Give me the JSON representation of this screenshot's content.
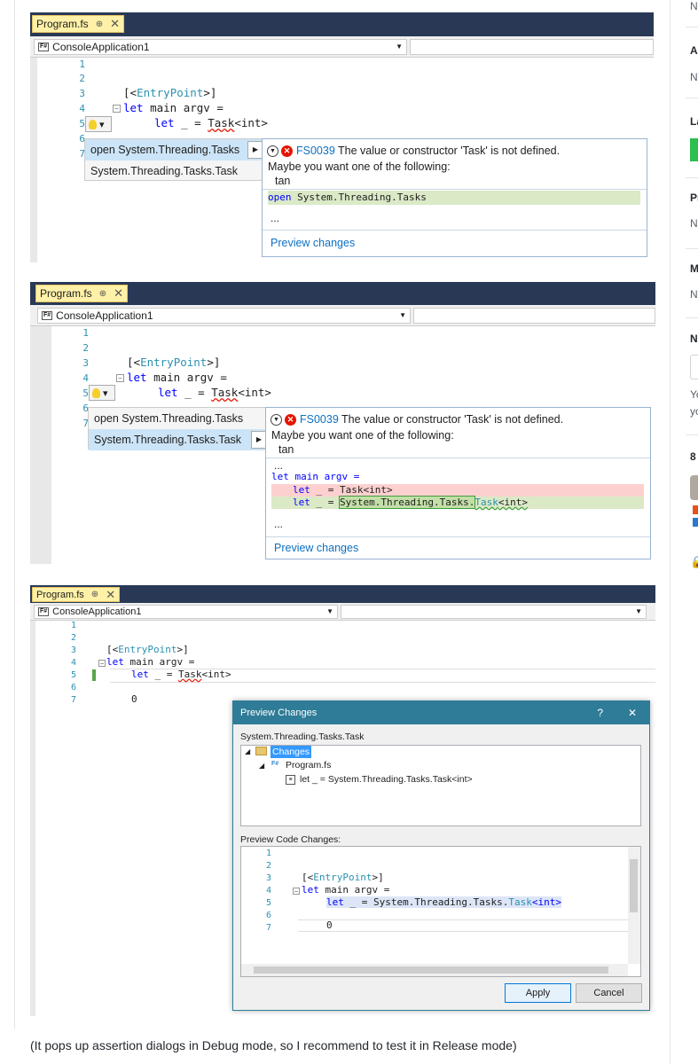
{
  "common": {
    "tab_title": "Program.fs",
    "pin_glyph": "⊕",
    "close_glyph": "✕",
    "project_name": "ConsoleApplication1",
    "fs_icon_text": "F#",
    "line_numbers": [
      "1",
      "2",
      "3",
      "4",
      "5",
      "6",
      "7"
    ],
    "code_attr_open": "[<",
    "code_attr_name": "EntryPoint",
    "code_attr_close": ">]",
    "code_let": "let",
    "code_main": " main argv =",
    "code_let_indent": "let",
    "code_underscore": " _ = ",
    "code_task": "Task",
    "code_int": "<int>",
    "code_zero": "0"
  },
  "shot1": {
    "menu_items": [
      "open System.Threading.Tasks",
      "System.Threading.Tasks.Task"
    ],
    "error_code": "FS0039",
    "error_message": "The value or constructor 'Task' is not defined.",
    "maybe": "Maybe you want one of the following:",
    "suggestion": "tan",
    "preview_kw": "open",
    "preview_ns": " System.Threading.Tasks",
    "ellipsis": "...",
    "preview_link": "Preview changes"
  },
  "shot2": {
    "menu_items": [
      "open System.Threading.Tasks",
      "System.Threading.Tasks.Task"
    ],
    "error_code": "FS0039",
    "error_message": "The value or constructor 'Task' is not defined.",
    "maybe": "Maybe you want one of the following:",
    "suggestion": "tan",
    "ellipsis": "...",
    "diff_line1": "let main argv =",
    "diff_old_let": "let",
    "diff_old_rest": " _ = Task<int>",
    "diff_new_let": "let",
    "diff_new_eq": " _ = ",
    "diff_new_ns": "System.Threading.Tasks.",
    "diff_new_task": "Task",
    "diff_new_int": "<int>",
    "preview_link": "Preview changes"
  },
  "dialog": {
    "title": "Preview Changes",
    "help": "?",
    "close": "✕",
    "subject": "System.Threading.Tasks.Task",
    "tree_root": "Changes",
    "tree_file": "Program.fs",
    "tree_change": "let _ = System.Threading.Tasks.Task<int>",
    "code_label": "Preview Code Changes:",
    "code_ns": "System.Threading.Tasks.",
    "code_task": "Task",
    "code_int": "<int>",
    "apply": "Apply",
    "cancel": "Cancel"
  },
  "sidebar": {
    "labels": [
      "N",
      "A",
      "N",
      "La",
      "Pr",
      "N",
      "M",
      "N",
      "N",
      "Yo",
      "yo",
      "8"
    ]
  },
  "caption": "(It pops up assertion dialogs in Debug mode, so I recommend to test it in Release mode)"
}
